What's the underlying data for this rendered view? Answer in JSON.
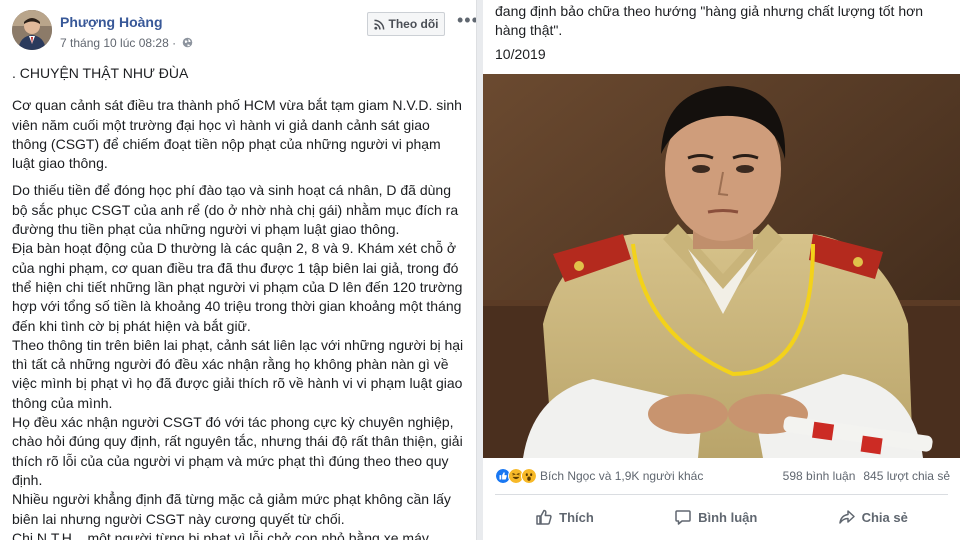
{
  "left_post": {
    "author": "Phượng Hoàng",
    "timestamp": "7 tháng 10 lúc 08:28 ·",
    "follow_label": "Theo dõi",
    "more_label": "•••",
    "title": ". CHUYỆN THẬT NHƯ ĐÙA",
    "paragraphs": [
      "Cơ quan cảnh sát điều tra thành phố HCM vừa bắt tạm giam N.V.D. sinh viên năm cuối một trường đại học vì hành vi giả danh cảnh sát giao thông (CSGT) để chiếm đoạt tiền nộp phạt của những người vi phạm luật giao thông.",
      "Do thiếu tiền để đóng học phí đào tạo và sinh hoạt cá nhân, D đã dùng bộ sắc phục CSGT của anh rể (do ở nhờ nhà chị gái) nhằm mục đích ra đường thu tiền phạt của những người vi phạm luật giao thông.",
      "Địa bàn hoạt động của D thường là các quận 2, 8 và 9. Khám xét chỗ ở của nghi phạm, cơ quan điều tra đã thu được 1 tập biên lai giả, trong đó thể hiện chi tiết những lần phạt người vi phạm của D lên đến 120 trường hợp với tổng số tiền là khoảng 40 triệu trong thời gian khoảng một tháng đến khi tình cờ bị phát hiện và bắt giữ.",
      "Theo thông tin trên biên lai phạt, cảnh sát liên lạc với những người bị hại thì tất cả những người đó đều xác nhận rằng họ không phàn nàn gì về việc mình bị phạt vì họ đã được giải thích rõ về hành vi vi phạm luật giao thông của mình.",
      "Họ đều xác nhận người CSGT đó với tác phong cực kỳ chuyên nghiệp, chào hỏi đúng quy định, rất nguyên tắc, nhưng thái độ rất thân thiện, giải thích rõ lỗi của của người vi phạm và mức phạt thì đúng theo theo quy định.",
      "Nhiều người khẳng định đã từng mặc cả giảm mức phạt không cần lấy biên lai nhưng người CSGT này cương quyết từ chối.",
      "Chị N.T.H. , một người từng bị phạt vì lỗi chở con nhỏ bằng xe máy không"
    ]
  },
  "right_post": {
    "top_text": "đang định bảo chữa theo hướng \"hàng giả nhưng chất lượng tốt hơn hàng thật\".",
    "date": "10/2019",
    "reactors": "Bích Ngọc và 1,9K người khác",
    "comments": "598 bình luận",
    "shares": "845 lượt chia sẻ",
    "like_label": "Thích",
    "comment_label": "Bình luận",
    "share_label": "Chia sẻ"
  },
  "colors": {
    "link_blue": "#385898",
    "like_blue": "#1877f2",
    "haha_yellow": "#f7b928",
    "meta_gray": "#606770"
  },
  "icons": [
    "globe-icon",
    "rss-icon",
    "more-icon",
    "like-reaction-icon",
    "haha-reaction-icon",
    "wow-reaction-icon",
    "thumbs-up-icon",
    "comment-icon",
    "share-icon"
  ]
}
